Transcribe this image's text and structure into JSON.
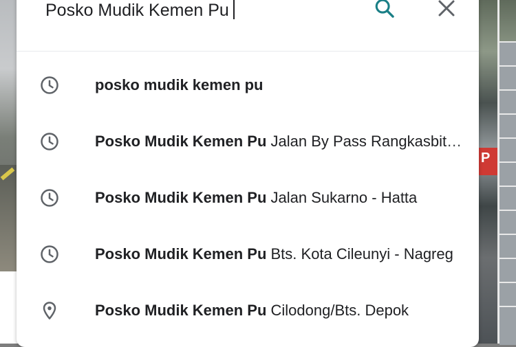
{
  "search": {
    "query": "Posko Mudik Kemen Pu",
    "search_icon": "search-icon",
    "close_icon": "close-icon"
  },
  "colors": {
    "accent": "#1a7f86",
    "icon_grey": "#5f6368",
    "text": "#202124"
  },
  "background": {
    "sign_letter": "P"
  },
  "suggestions": [
    {
      "icon": "history-clock-icon",
      "main": "",
      "rest": "posko mudik kemen pu"
    },
    {
      "icon": "history-clock-icon",
      "main": "Posko Mudik Kemen Pu",
      "rest": " Jalan By Pass Rangkasbitung"
    },
    {
      "icon": "history-clock-icon",
      "main": "Posko Mudik Kemen Pu",
      "rest": " Jalan Sukarno - Hatta"
    },
    {
      "icon": "history-clock-icon",
      "main": "Posko Mudik Kemen Pu",
      "rest": " Bts. Kota Cileunyi - Nagreg"
    },
    {
      "icon": "map-pin-icon",
      "main": "Posko Mudik Kemen Pu",
      "rest": " Cilodong/Bts. Depok"
    }
  ]
}
